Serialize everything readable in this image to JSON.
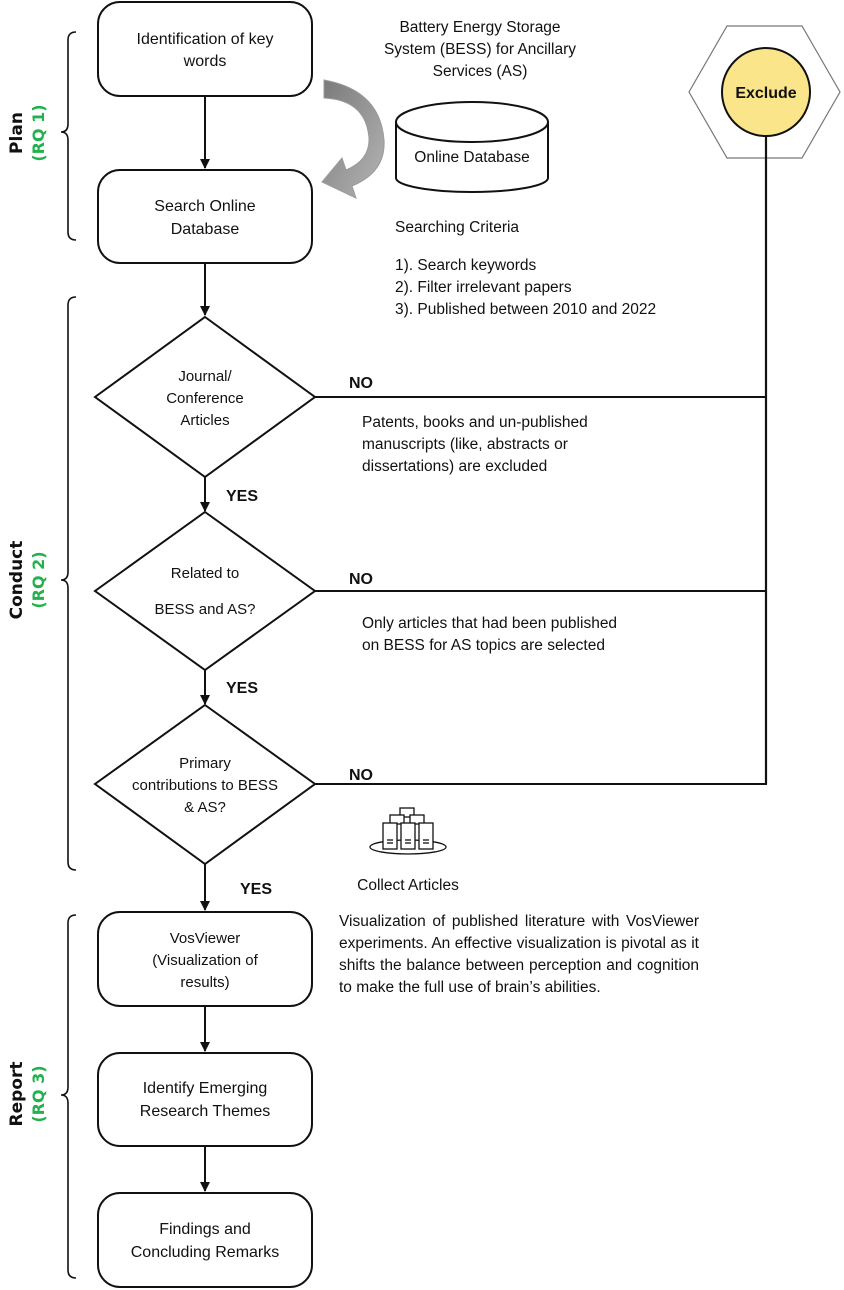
{
  "phases": [
    {
      "name": "Plan",
      "rq": "(RQ 1)"
    },
    {
      "name": "Conduct",
      "rq": "(RQ 2)"
    },
    {
      "name": "Report",
      "rq": "(RQ 3)"
    }
  ],
  "process_boxes": {
    "identification": [
      "Identification of key",
      "words"
    ],
    "search": [
      "Search Online",
      "Database"
    ],
    "vosviewer": [
      "VosViewer",
      "(Visualization of",
      "results)"
    ],
    "identify_themes": [
      "Identify Emerging",
      "Research Themes"
    ],
    "findings": [
      "Findings and",
      "Concluding Remarks"
    ]
  },
  "decisions": {
    "journal": [
      "Journal/",
      "Conference",
      "Articles"
    ],
    "related": [
      "Related to",
      "BESS and AS?"
    ],
    "primary": [
      "Primary",
      "contributions to BESS",
      "& AS?"
    ]
  },
  "labels": {
    "yes": "YES",
    "no": "NO",
    "exclude": "Exclude",
    "collect_articles": "Collect Articles",
    "database": "Online Database"
  },
  "topic_title": [
    "Battery Energy Storage",
    "System (BESS) for Ancillary",
    "Services (AS)"
  ],
  "searching_criteria": {
    "title": "Searching Criteria",
    "items": [
      "1). Search keywords",
      "2). Filter irrelevant papers",
      "3). Published between 2010 and 2022"
    ]
  },
  "exclusion_notes": {
    "journal": [
      "Patents, books and un-published",
      "manuscripts (like, abstracts or",
      "dissertations) are excluded"
    ],
    "related": [
      "Only articles that had been published",
      "on BESS for AS topics are selected"
    ]
  },
  "visualization_note": "Visualization of published literature with VosViewer experiments. An effective visualization is pivotal as it shifts the balance between perception and cognition to make the full use of brain’s abilities.",
  "colors": {
    "rq_green": "#22b14c",
    "exclude_fill": "#fbe58a",
    "curved_arrow": "#8c8c8c"
  }
}
